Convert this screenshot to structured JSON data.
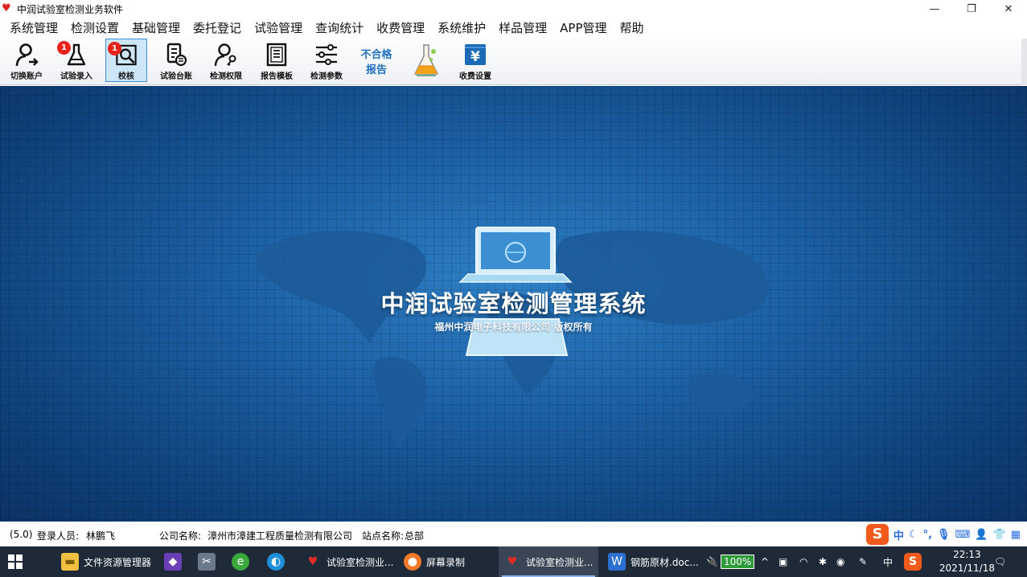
{
  "window": {
    "title": "中润试验室检测业务软件",
    "minimize": "—",
    "restore": "❐",
    "close": "✕"
  },
  "menu": [
    "系统管理",
    "检测设置",
    "基础管理",
    "委托登记",
    "试验管理",
    "查询统计",
    "收费管理",
    "系统维护",
    "样品管理",
    "APP管理",
    "帮助"
  ],
  "toolbar": {
    "switch_account": "切换账户",
    "test_entry": "试验录入",
    "test_entry_badge": "1",
    "review": "校核",
    "review_badge": "1",
    "ledger": "试验台账",
    "permission": "检测权限",
    "report_template": "报告模板",
    "test_params": "检测参数",
    "nonconform_line1": "不合格",
    "nonconform_line2": "报告",
    "fee_settings": "收费设置",
    "fee_icon": "¥",
    "tooltip": "校核"
  },
  "main": {
    "title": "中润试验室检测管理系统",
    "subtitle": "福州中润电子科技有限公司 版权所有"
  },
  "status": {
    "version": "(5.0)",
    "login_label": "登录人员:",
    "login_user": "林鹏飞",
    "company_label": "公司名称:",
    "company": "漳州市漳建工程质量检测有限公司",
    "site_label": "站点名称:",
    "site": "总部"
  },
  "ime": {
    "logo": "S",
    "mode": "中"
  },
  "taskbar": {
    "explorer": "文件资源管理器",
    "app1": "试验室检测业...",
    "recorder": "屏幕录制",
    "app2": "试验室检测业...",
    "word": "钢筋原材.doc...",
    "battery": "100%",
    "lang": "中",
    "time": "22:13",
    "date": "2021/11/18"
  },
  "colors": {
    "accent": "#1b5fa3",
    "badge": "#e8221a",
    "nonconform": "#1f6fbf"
  }
}
